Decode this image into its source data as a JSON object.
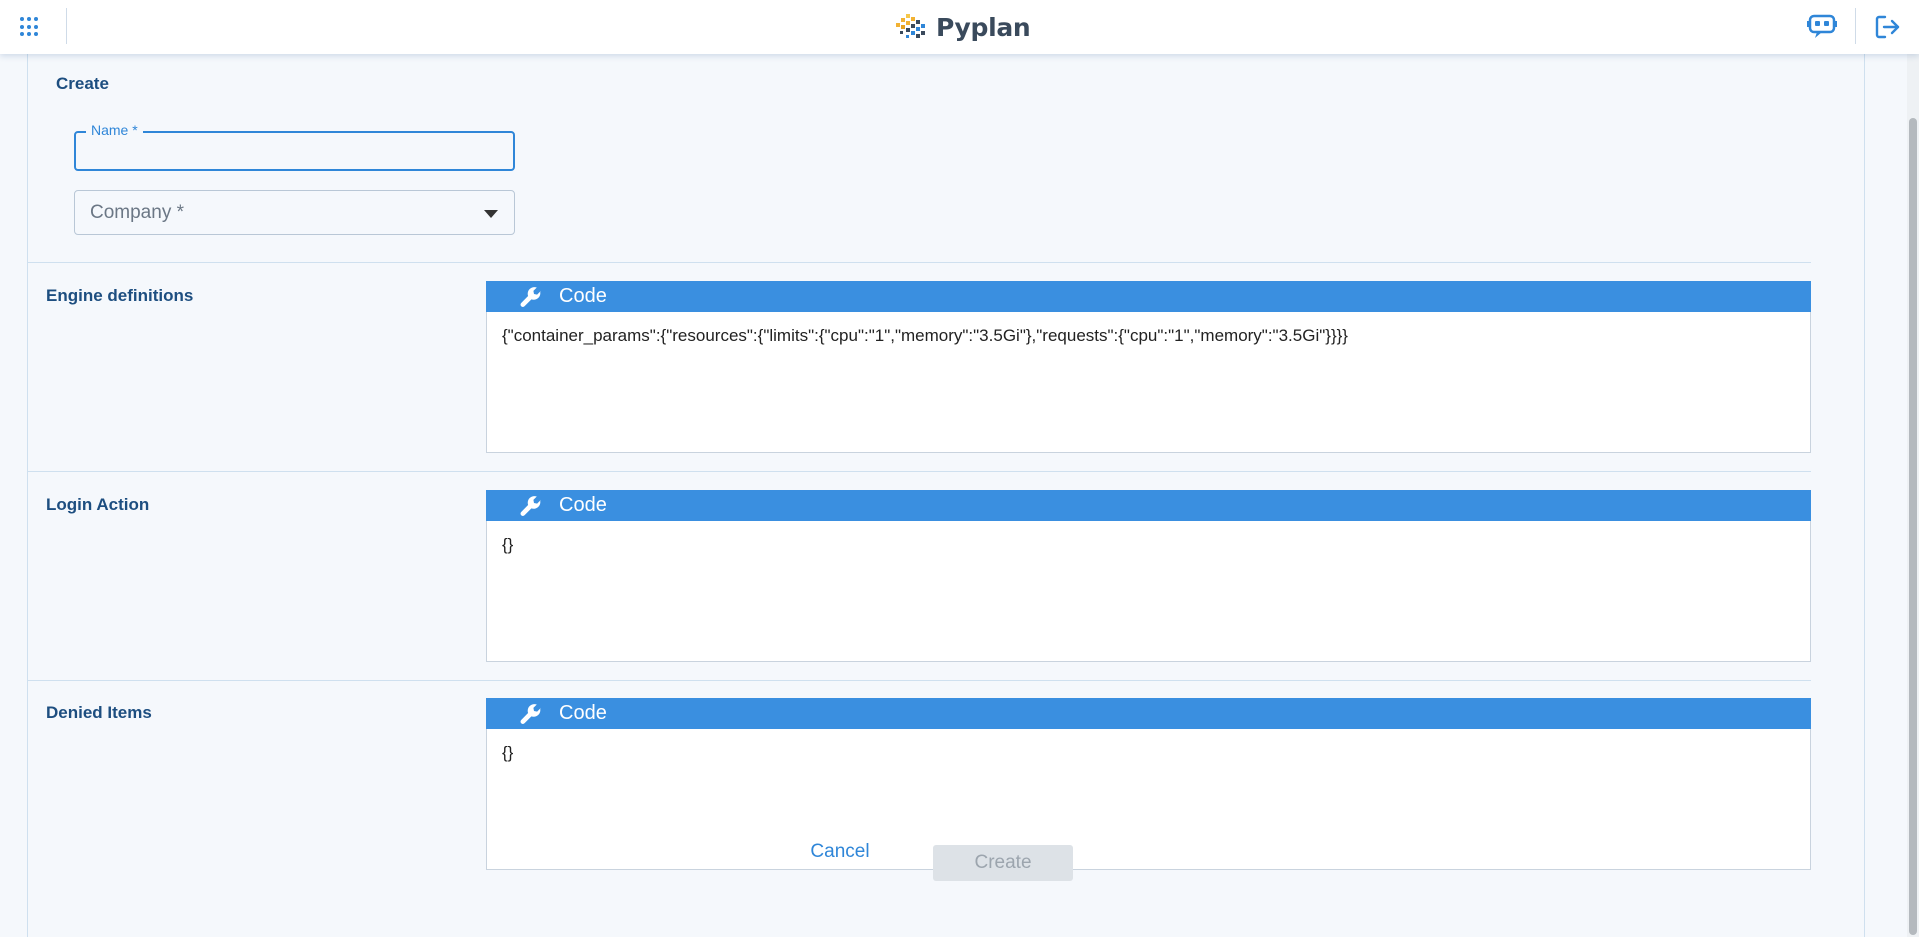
{
  "app": {
    "brand_name": "Pyplan",
    "accent_color": "#2f86d8",
    "icons": {
      "apps": "apps-grid-icon",
      "assistant": "assistant-bot-icon",
      "logout": "logout-icon",
      "wrench": "wrench-icon",
      "dropdown": "chevron-down-icon"
    }
  },
  "form": {
    "title": "Create",
    "name_field": {
      "label": "Name *",
      "value": ""
    },
    "company_field": {
      "placeholder": "Company *",
      "value": ""
    },
    "sections": [
      {
        "label": "Engine definitions",
        "header_label": "Code",
        "content": "{\"container_params\":{\"resources\":{\"limits\":{\"cpu\":\"1\",\"memory\":\"3.5Gi\"},\"requests\":{\"cpu\":\"1\",\"memory\":\"3.5Gi\"}}}}"
      },
      {
        "label": "Login Action",
        "header_label": "Code",
        "content": "{}"
      },
      {
        "label": "Denied Items",
        "header_label": "Code",
        "content": "{}"
      }
    ],
    "cancel_label": "Cancel",
    "create_label": "Create"
  }
}
